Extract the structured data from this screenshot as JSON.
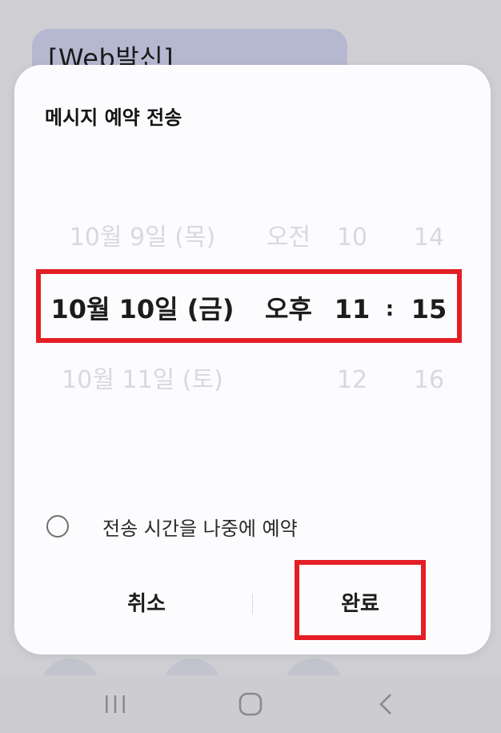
{
  "background": {
    "bubble_text": "[Web발신]"
  },
  "dialog": {
    "title": "메시지 예약 전송",
    "picker": {
      "above": {
        "date": "10월 9일 (목)",
        "ampm": "오전",
        "hour": "10",
        "minute": "14"
      },
      "selected": {
        "date": "10월 10일 (금)",
        "ampm": "오후",
        "hour": "11",
        "separator": ":",
        "minute": "15"
      },
      "below": {
        "date": "10월 11일 (토)",
        "ampm": "",
        "hour": "12",
        "minute": "16"
      }
    },
    "option": {
      "label": "전송 시간을 나중에 예약",
      "checked": false
    },
    "buttons": {
      "cancel": "취소",
      "done": "완료"
    }
  },
  "colors": {
    "annotation_red": "#e41e26",
    "dialog_bg": "#fcfcff",
    "page_bg": "#cfcfd3"
  },
  "navbar": {
    "icons": [
      "recent-apps-icon",
      "home-icon",
      "back-icon"
    ]
  }
}
